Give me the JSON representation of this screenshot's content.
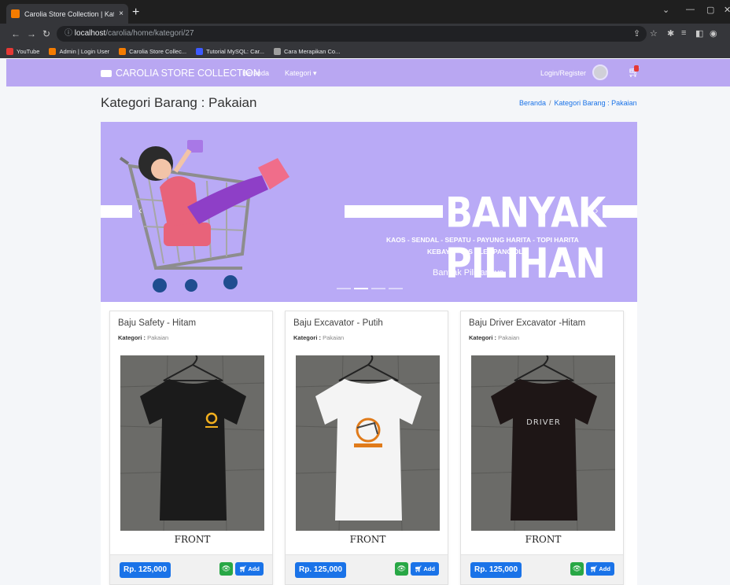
{
  "browser": {
    "tab_title": "Carolia Store Collection | Katego",
    "tab_close": "×",
    "new_tab": "+",
    "url_host": "localhost",
    "url_path": "/carolia/home/kategori/27",
    "bookmarks": [
      {
        "label": "YouTube",
        "color": "#e53935"
      },
      {
        "label": "Admin | Login User",
        "color": "#f57c00"
      },
      {
        "label": "Carolia Store Collec...",
        "color": "#f57c00"
      },
      {
        "label": "Tutorial MySQL: Car...",
        "color": "#3d5afe"
      },
      {
        "label": "Cara Merapikan Co...",
        "color": "#9e9e9e"
      }
    ]
  },
  "navbar": {
    "brand": "CAROLIA STORE COLLECTION",
    "beranda": "Beranda",
    "kategori": "Kategori ▾",
    "login": "Login/Register",
    "bg_color": "#b9a7f2"
  },
  "page": {
    "title": "Kategori Barang : Pakaian",
    "breadcrumb_home": "Beranda",
    "breadcrumb_sep": "/",
    "breadcrumb_current": "Kategori Barang : Pakaian"
  },
  "banner": {
    "headline": "BANYAK PILIHAN",
    "sub_line1": "KAOS - SENDAL - SEPATU - PAYUNG HARITA - TOPI HARITA",
    "sub_line2": "KEBAYA - TAS SLEMPANG DLL",
    "caption": "Banyak Pilihannya",
    "active_slide": 2,
    "slide_count": 4
  },
  "products": [
    {
      "name": "Baju Safety - Hitam",
      "category_label": "Kategori :",
      "category": "Pakaian",
      "front_label": "FRONT",
      "price": "Rp. 125,000",
      "add_label": "Add",
      "shirt_color": "#1b1b1b",
      "logo_text": ""
    },
    {
      "name": "Baju Excavator - Putih",
      "category_label": "Kategori :",
      "category": "Pakaian",
      "front_label": "FRONT",
      "price": "Rp. 125,000",
      "add_label": "Add",
      "shirt_color": "#f4f4f4",
      "logo_text": ""
    },
    {
      "name": "Baju Driver Excavator -Hitam",
      "category_label": "Kategori :",
      "category": "Pakaian",
      "front_label": "FRONT",
      "price": "Rp. 125,000",
      "add_label": "Add",
      "shirt_color": "#1e1616",
      "logo_text": "DRIVER"
    }
  ]
}
